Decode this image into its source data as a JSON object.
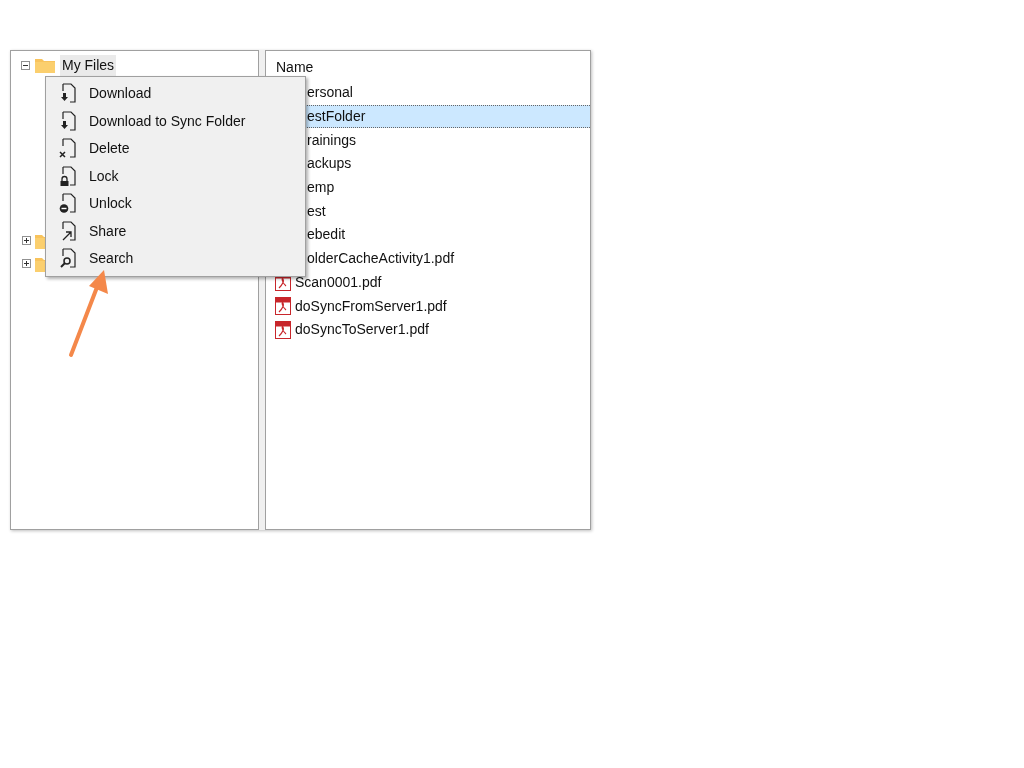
{
  "tree": {
    "label": "My Files",
    "expanded": true,
    "children": [
      {
        "expanded": false
      },
      {
        "expanded": false
      }
    ]
  },
  "context_menu": [
    {
      "label": "Download",
      "kind": "download"
    },
    {
      "label": "Download to Sync Folder",
      "kind": "download"
    },
    {
      "label": "Delete",
      "kind": "delete"
    },
    {
      "label": "Lock",
      "kind": "lock"
    },
    {
      "label": "Unlock",
      "kind": "unlock"
    },
    {
      "label": "Share",
      "kind": "share"
    },
    {
      "label": "Search",
      "kind": "search"
    }
  ],
  "file_list": {
    "column": "Name",
    "rows": [
      {
        "name": "ersonal",
        "kind": "covered",
        "selected": false
      },
      {
        "name": "estFolder",
        "kind": "covered",
        "selected": true
      },
      {
        "name": "rainings",
        "kind": "covered",
        "selected": false
      },
      {
        "name": "ackups",
        "kind": "covered",
        "selected": false
      },
      {
        "name": "emp",
        "kind": "covered",
        "selected": false
      },
      {
        "name": "est",
        "kind": "covered",
        "selected": false
      },
      {
        "name": "ebedit",
        "kind": "covered",
        "selected": false
      },
      {
        "name": "olderCacheActivity1.pdf",
        "kind": "covered",
        "selected": false
      },
      {
        "name": "Scan0001.pdf",
        "kind": "pdf",
        "selected": false
      },
      {
        "name": "doSyncFromServer1.pdf",
        "kind": "pdf",
        "selected": false
      },
      {
        "name": "doSyncToServer1.pdf",
        "kind": "pdf",
        "selected": false
      }
    ]
  }
}
